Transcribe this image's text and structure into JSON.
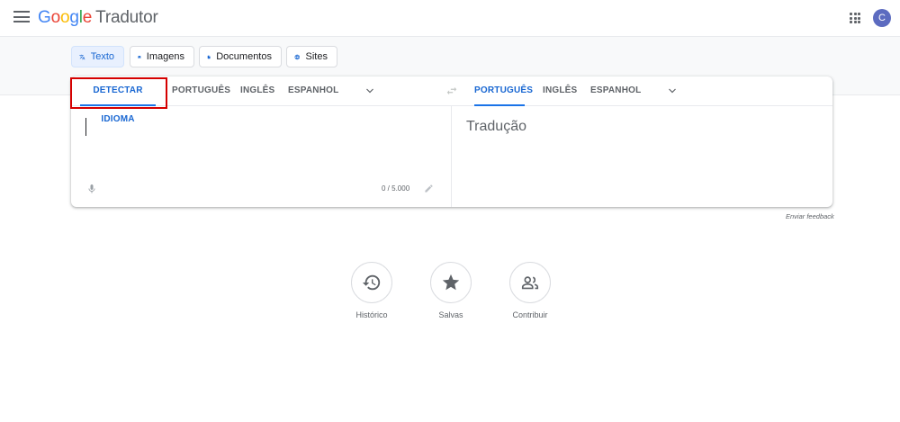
{
  "header": {
    "logo_google": [
      "G",
      "o",
      "o",
      "g",
      "l",
      "e"
    ],
    "product_name": "Tradutor",
    "avatar_letter": "C"
  },
  "modes": [
    {
      "label": "Texto",
      "icon": "translate-icon",
      "active": true
    },
    {
      "label": "Imagens",
      "icon": "image-icon",
      "active": false
    },
    {
      "label": "Documentos",
      "icon": "document-icon",
      "active": false
    },
    {
      "label": "Sites",
      "icon": "globe-icon",
      "active": false
    }
  ],
  "source_tabs": [
    "DETECTAR IDIOMA",
    "PORTUGUÊS",
    "INGLÊS",
    "ESPANHOL"
  ],
  "target_tabs": [
    "PORTUGUÊS",
    "INGLÊS",
    "ESPANHOL"
  ],
  "source": {
    "value": "",
    "char_count": "0 / 5.000"
  },
  "target": {
    "placeholder": "Tradução"
  },
  "feedback_link": "Enviar feedback",
  "bottom_actions": [
    {
      "label": "Histórico",
      "icon": "history-icon"
    },
    {
      "label": "Salvas",
      "icon": "star-icon"
    },
    {
      "label": "Contribuir",
      "icon": "people-icon"
    }
  ],
  "colors": {
    "accent": "#1a73e8",
    "highlight_box": "#d50000"
  }
}
